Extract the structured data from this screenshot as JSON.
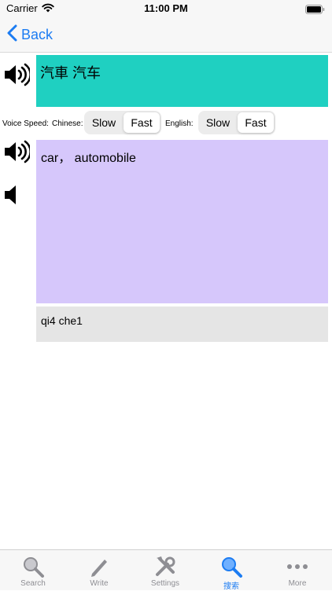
{
  "status_bar": {
    "carrier": "Carrier",
    "time": "11:00 PM"
  },
  "nav": {
    "back_label": "Back"
  },
  "entry": {
    "chinese": "汽車 汽车",
    "english": "car， automobile",
    "pinyin": "qi4 che1"
  },
  "voice_speed": {
    "label": "Voice Speed:",
    "chinese_label": "Chinese:",
    "english_label": "English:",
    "chinese_options": [
      "Slow",
      "Fast"
    ],
    "chinese_selected": "Fast",
    "english_options": [
      "Slow",
      "Fast"
    ],
    "english_selected": "Fast"
  },
  "tab_bar": {
    "items": [
      {
        "label": "Search",
        "icon": "magnifier-icon"
      },
      {
        "label": "Write",
        "icon": "pencil-icon"
      },
      {
        "label": "Settings",
        "icon": "tools-icon"
      },
      {
        "label": "搜索",
        "icon": "magnifier-icon"
      },
      {
        "label": "More",
        "icon": "more-dots-icon"
      }
    ],
    "active_index": 3
  },
  "colors": {
    "accent": "#1c7cf2",
    "chinese_box": "#1fd0c1",
    "english_box": "#d6c7fb",
    "pinyin_box": "#e5e5e5"
  }
}
